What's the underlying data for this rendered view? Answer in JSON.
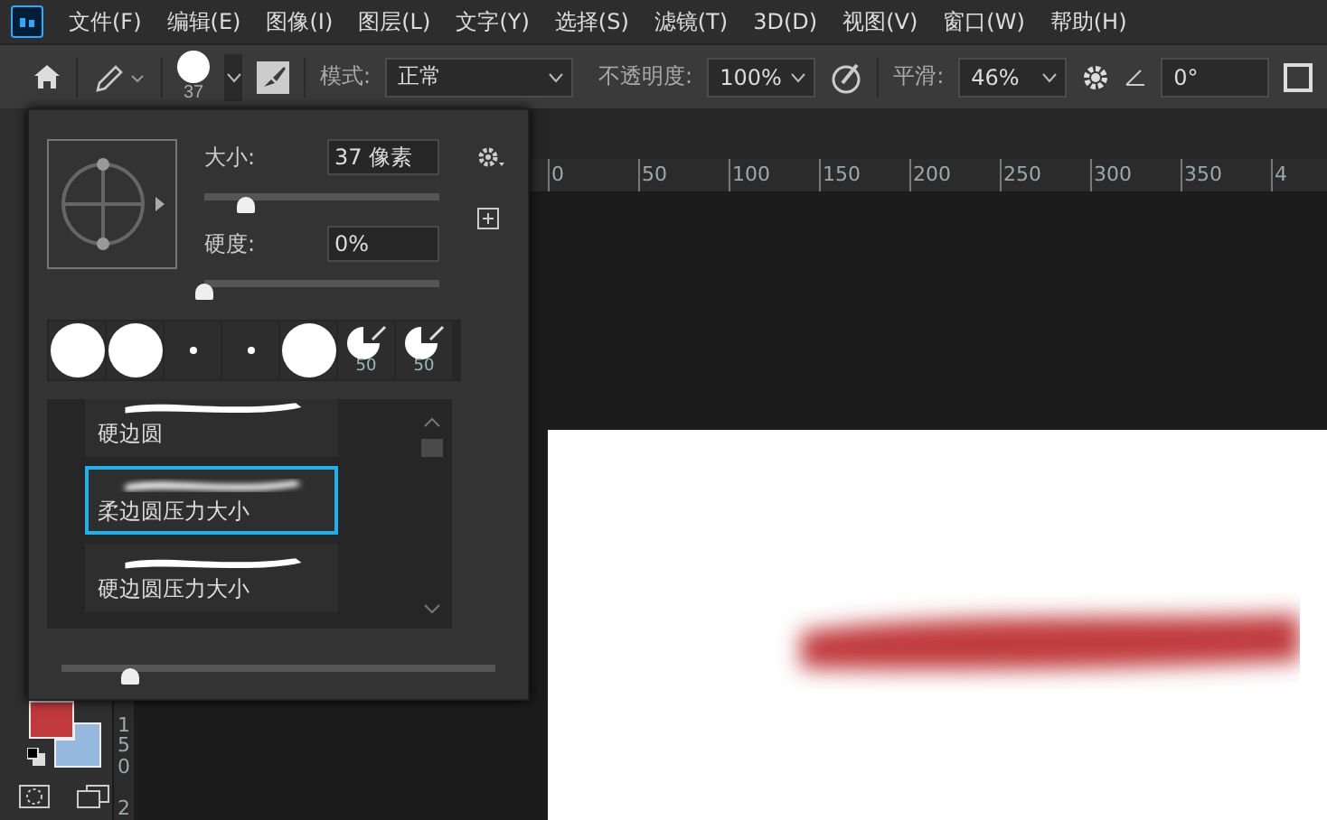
{
  "menu_bar": {
    "items": [
      "文件(F)",
      "编辑(E)",
      "图像(I)",
      "图层(L)",
      "文字(Y)",
      "选择(S)",
      "滤镜(T)",
      "3D(D)",
      "视图(V)",
      "窗口(W)",
      "帮助(H)"
    ]
  },
  "options_bar": {
    "brush_size": "37",
    "mode_label": "模式:",
    "mode_value": "正常",
    "opacity_label": "不透明度:",
    "opacity_value": "100%",
    "smoothing_label": "平滑:",
    "smoothing_value": "46%",
    "angle_value": "0°"
  },
  "brush_panel": {
    "size_label": "大小:",
    "size_value": "37 像素",
    "size_slider": {
      "level": 0.18
    },
    "hardness_label": "硬度:",
    "hardness_value": "0%",
    "hardness_slider": {
      "level": 0
    },
    "tips": [
      {
        "kind": "large"
      },
      {
        "kind": "large"
      },
      {
        "kind": "dot"
      },
      {
        "kind": "dot"
      },
      {
        "kind": "large"
      },
      {
        "kind": "pressure",
        "caption": "50"
      },
      {
        "kind": "pressure",
        "caption": "50"
      }
    ],
    "presets": [
      {
        "name": "硬边圆",
        "kind": "hard",
        "selected": false
      },
      {
        "name": "柔边圆压力大小",
        "kind": "soft",
        "selected": true
      },
      {
        "name": "硬边圆压力大小",
        "kind": "hard",
        "selected": false
      }
    ],
    "preview_slider": {
      "level": 0.16
    }
  },
  "ruler": {
    "labels": [
      "0",
      "50",
      "100",
      "150",
      "200",
      "250",
      "300",
      "350",
      "4"
    ]
  },
  "vertical_ruler": {
    "labels": [
      "150",
      "2"
    ]
  },
  "color_swatches": [
    {
      "kind": "background",
      "color": "#94b8de"
    },
    {
      "kind": "foreground",
      "color": "#c0393b"
    }
  ]
}
